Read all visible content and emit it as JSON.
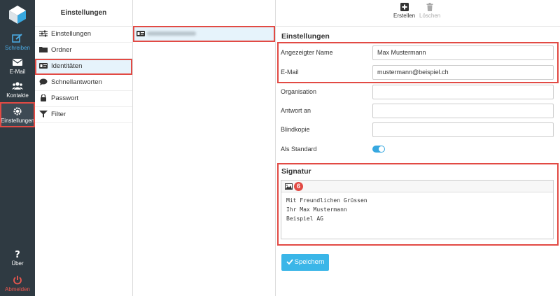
{
  "nav": {
    "items": [
      {
        "label": "Schreiben",
        "icon": "compose-icon"
      },
      {
        "label": "E-Mail",
        "icon": "envelope-icon"
      },
      {
        "label": "Kontakte",
        "icon": "contacts-icon"
      },
      {
        "label": "Einstellungen",
        "icon": "gear-icon"
      }
    ],
    "bottom": [
      {
        "label": "Über",
        "icon": "question-icon"
      },
      {
        "label": "Abmelden",
        "icon": "power-icon"
      }
    ]
  },
  "settings_menu": {
    "title": "Einstellungen",
    "items": [
      {
        "label": "Einstellungen",
        "icon": "sliders-icon"
      },
      {
        "label": "Ordner",
        "icon": "folder-icon"
      },
      {
        "label": "Identitäten",
        "icon": "id-card-icon"
      },
      {
        "label": "Schnellantworten",
        "icon": "comment-icon"
      },
      {
        "label": "Passwort",
        "icon": "lock-icon"
      },
      {
        "label": "Filter",
        "icon": "filter-icon"
      }
    ]
  },
  "toolbar": {
    "create_label": "Erstellen",
    "delete_label": "Löschen"
  },
  "form": {
    "section_title": "Einstellungen",
    "fields": [
      {
        "label": "Angezeigter Name",
        "value": "Max Mustermann"
      },
      {
        "label": "E-Mail",
        "value": "mustermann@beispiel.ch"
      },
      {
        "label": "Organisation",
        "value": ""
      },
      {
        "label": "Antwort an",
        "value": ""
      },
      {
        "label": "Blindkopie",
        "value": ""
      }
    ],
    "default_label": "Als Standard",
    "default_on": true
  },
  "signature": {
    "title": "Signatur",
    "badge": "6",
    "lines": [
      "Mit Freundlichen Grüssen",
      "Ihr Max Mustermann",
      "Beispiel AG"
    ]
  },
  "save_label": "Speichern",
  "colors": {
    "accent": "#37a8e0",
    "highlight": "#e24a44",
    "nav_bg": "#2f3a42"
  }
}
